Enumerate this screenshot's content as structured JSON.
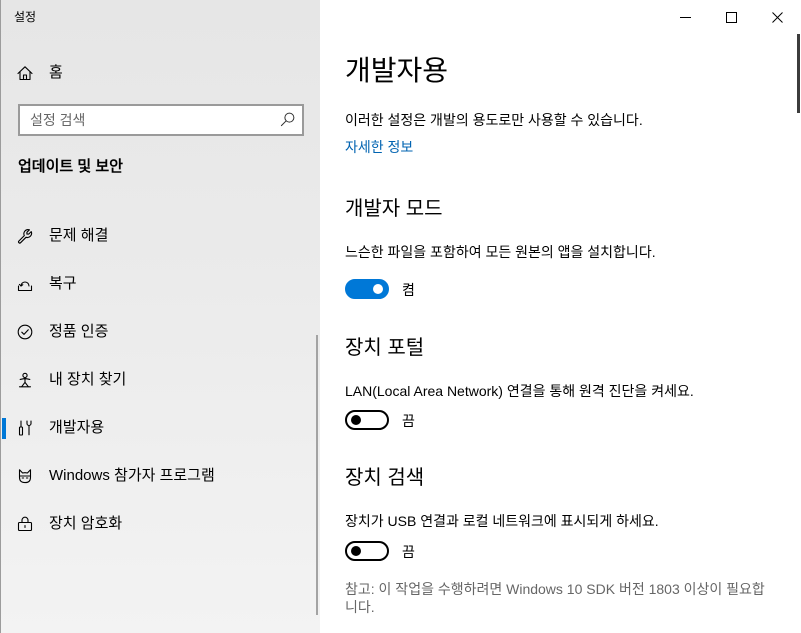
{
  "window": {
    "title": "설정",
    "buttons": {
      "minimize": "minimize-icon",
      "maximize": "maximize-icon",
      "close": "close-icon"
    }
  },
  "sidebar": {
    "home": {
      "label": "홈",
      "icon": "home-icon"
    },
    "search": {
      "placeholder": "설정 검색",
      "icon": "search-icon"
    },
    "section_title": "업데이트 및 보안",
    "items": [
      {
        "label": "문제 해결",
        "icon": "wrench-icon",
        "selected": false
      },
      {
        "label": "복구",
        "icon": "recovery-icon",
        "selected": false
      },
      {
        "label": "정품 인증",
        "icon": "activation-check-icon",
        "selected": false
      },
      {
        "label": "내 장치 찾기",
        "icon": "find-my-device-icon",
        "selected": false
      },
      {
        "label": "개발자용",
        "icon": "developer-tools-icon",
        "selected": true
      },
      {
        "label": "Windows 참가자 프로그램",
        "icon": "insider-cat-icon",
        "selected": false
      },
      {
        "label": "장치 암호화",
        "icon": "device-encryption-icon",
        "selected": false
      }
    ]
  },
  "main": {
    "title": "개발자용",
    "intro": "이러한 설정은 개발의 용도로만 사용할 수 있습니다.",
    "learn_more_link": "자세한 정보",
    "sections": [
      {
        "heading": "개발자 모드",
        "description": "느슨한 파일을 포함하여 모든 원본의 앱을 설치합니다.",
        "toggle": {
          "on": true,
          "label": "켬"
        }
      },
      {
        "heading": "장치 포털",
        "description": "LAN(Local Area Network) 연결을 통해 원격 진단을 켜세요.",
        "toggle": {
          "on": false,
          "label": "끔"
        }
      },
      {
        "heading": "장치 검색",
        "description": "장치가 USB 연결과 로컬 네트워크에 표시되게 하세요.",
        "toggle": {
          "on": false,
          "label": "끔"
        }
      }
    ],
    "note": "참고: 이 작업을 수행하려면 Windows 10 SDK 버전 1803 이상이 필요합니다."
  },
  "colors": {
    "accent": "#0078d7",
    "link": "#0063b1",
    "secondary_text": "#666666"
  }
}
